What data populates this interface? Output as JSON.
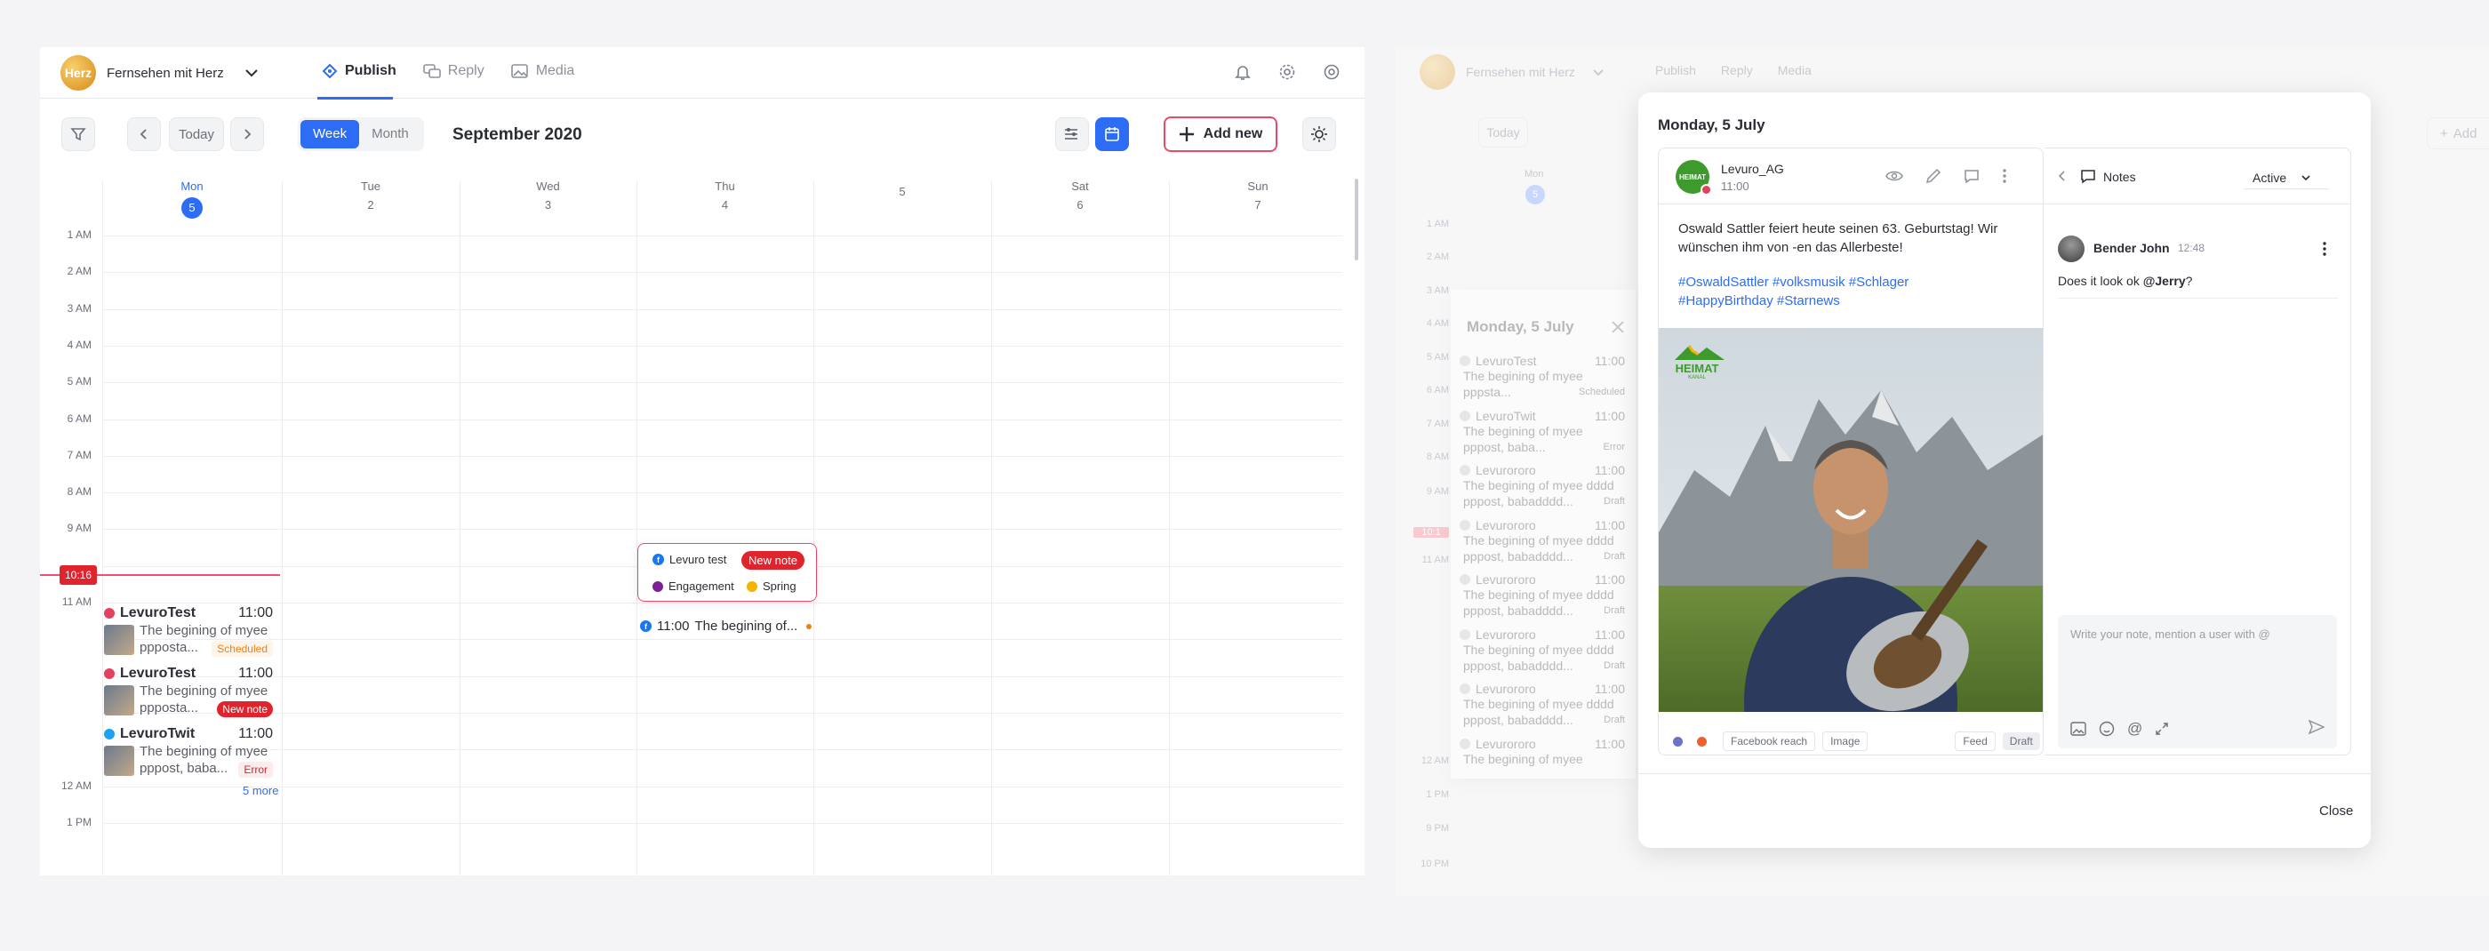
{
  "left": {
    "brand": {
      "name": "Fernsehen mit Herz",
      "logo_text": "Herz"
    },
    "nav": {
      "publish": "Publish",
      "reply": "Reply",
      "media": "Media"
    },
    "toolbar": {
      "today": "Today",
      "week": "Week",
      "month": "Month",
      "title": "September 2020",
      "add_new": "Add new"
    },
    "days": [
      {
        "name": "Mon",
        "num": "5"
      },
      {
        "name": "Tue",
        "num": "2"
      },
      {
        "name": "Wed",
        "num": "3"
      },
      {
        "name": "Thu",
        "num": "4"
      },
      {
        "name": "",
        "num": "5"
      },
      {
        "name": "Sat",
        "num": "6"
      },
      {
        "name": "Sun",
        "num": "7"
      }
    ],
    "hours": [
      "1 AM",
      "2 AM",
      "3 AM",
      "4 AM",
      "5 AM",
      "6 AM",
      "7 AM",
      "8 AM",
      "9 AM",
      "",
      "11 AM",
      "",
      "",
      "",
      "",
      "12 AM",
      "1 PM"
    ],
    "now": "10:16",
    "posts": [
      {
        "name": "LevuroTest",
        "time": "11:00",
        "line1": "The begining of myee",
        "line2": "ppposta...",
        "tag": "Scheduled",
        "tag_color": "#f07f14"
      },
      {
        "name": "LevuroTest",
        "time": "11:00",
        "line1": "The begining of myee",
        "line2": "ppposta...",
        "tag": "New note",
        "tag_color": "#e0242e"
      },
      {
        "name": "LevuroTwit",
        "time": "11:00",
        "line1": "The begining of myee",
        "line2": "pppost, baba...",
        "tag": "Error",
        "tag_color": "#e0242e"
      }
    ],
    "more": "5 more",
    "popover": {
      "account": "Levuro test",
      "badge": "New note",
      "label1": "Engagement",
      "label2": "Spring"
    },
    "thu_event": {
      "time": "11:00",
      "text": "The begining of..."
    }
  },
  "right": {
    "brand": "Fernsehen mit Herz",
    "nav": {
      "publish": "Publish",
      "reply": "Reply",
      "media": "Media"
    },
    "today": "Today",
    "add": "Add",
    "mon": "Mon",
    "mon_num": "5",
    "hours": [
      "1 AM",
      "2 AM",
      "3 AM",
      "4 AM",
      "5 AM",
      "6 AM",
      "7 AM",
      "8 AM",
      "9 AM",
      "10:1",
      "11 AM",
      "12 AM",
      "1 PM",
      "9 PM",
      "10 PM"
    ],
    "list": {
      "title": "Monday, 5 July",
      "items": [
        {
          "name": "LevuroTest",
          "time": "11:00",
          "l1": "The begining of myee",
          "l2": "pppsta...",
          "tag": "Scheduled"
        },
        {
          "name": "LevuroTwit",
          "time": "11:00",
          "l1": "The begining of myee",
          "l2": "pppost, baba...",
          "tag": "Error"
        },
        {
          "name": "Levurororo",
          "time": "11:00",
          "l1": "The begining of myee dddd",
          "l2": "pppost, babadddd...",
          "tag": "Draft"
        },
        {
          "name": "Levurororo",
          "time": "11:00",
          "l1": "The begining of myee dddd",
          "l2": "pppost, babadddd...",
          "tag": "Draft"
        },
        {
          "name": "Levurororo",
          "time": "11:00",
          "l1": "The begining of myee dddd",
          "l2": "pppost, babadddd...",
          "tag": "Draft"
        },
        {
          "name": "Levurororo",
          "time": "11:00",
          "l1": "The begining of myee dddd",
          "l2": "pppost, babadddd...",
          "tag": "Draft"
        },
        {
          "name": "Levurororo",
          "time": "11:00",
          "l1": "The begining of myee dddd",
          "l2": "pppost, babadddd...",
          "tag": "Draft"
        },
        {
          "name": "Levurororo",
          "time": "11:00",
          "l1": "The begining of myee",
          "l2": "",
          "tag": ""
        }
      ]
    },
    "modal": {
      "title": "Monday, 5 July",
      "post": {
        "account": "Levuro_AG",
        "time": "11:00",
        "text": "Oswald Sattler feiert heute seinen 63. Geburtstag! Wir wünschen ihm von     -en das Allerbeste!",
        "hashtags1": "#OswaldSattler #volksmusik #Schlager",
        "hashtags2": "#HappyBirthday #Starnews",
        "logo_text": "HEIMAT",
        "logo_sub": "KANAL",
        "footer": {
          "reach": "Facebook reach",
          "image": "Image",
          "feed": "Feed",
          "draft": "Draft"
        }
      },
      "notes": {
        "title": "Notes",
        "filter": "Active",
        "author": "Bender John",
        "time": "12:48",
        "text_pre": "Does it look ok ",
        "mention": "@Jerry",
        "text_post": "?",
        "placeholder": "Write your note, mention a user with @"
      },
      "close": "Close"
    }
  },
  "colors": {
    "accent": "#2d6df6",
    "danger": "#e0242e",
    "warning": "#f07f14",
    "now_line": "#f0506e"
  }
}
